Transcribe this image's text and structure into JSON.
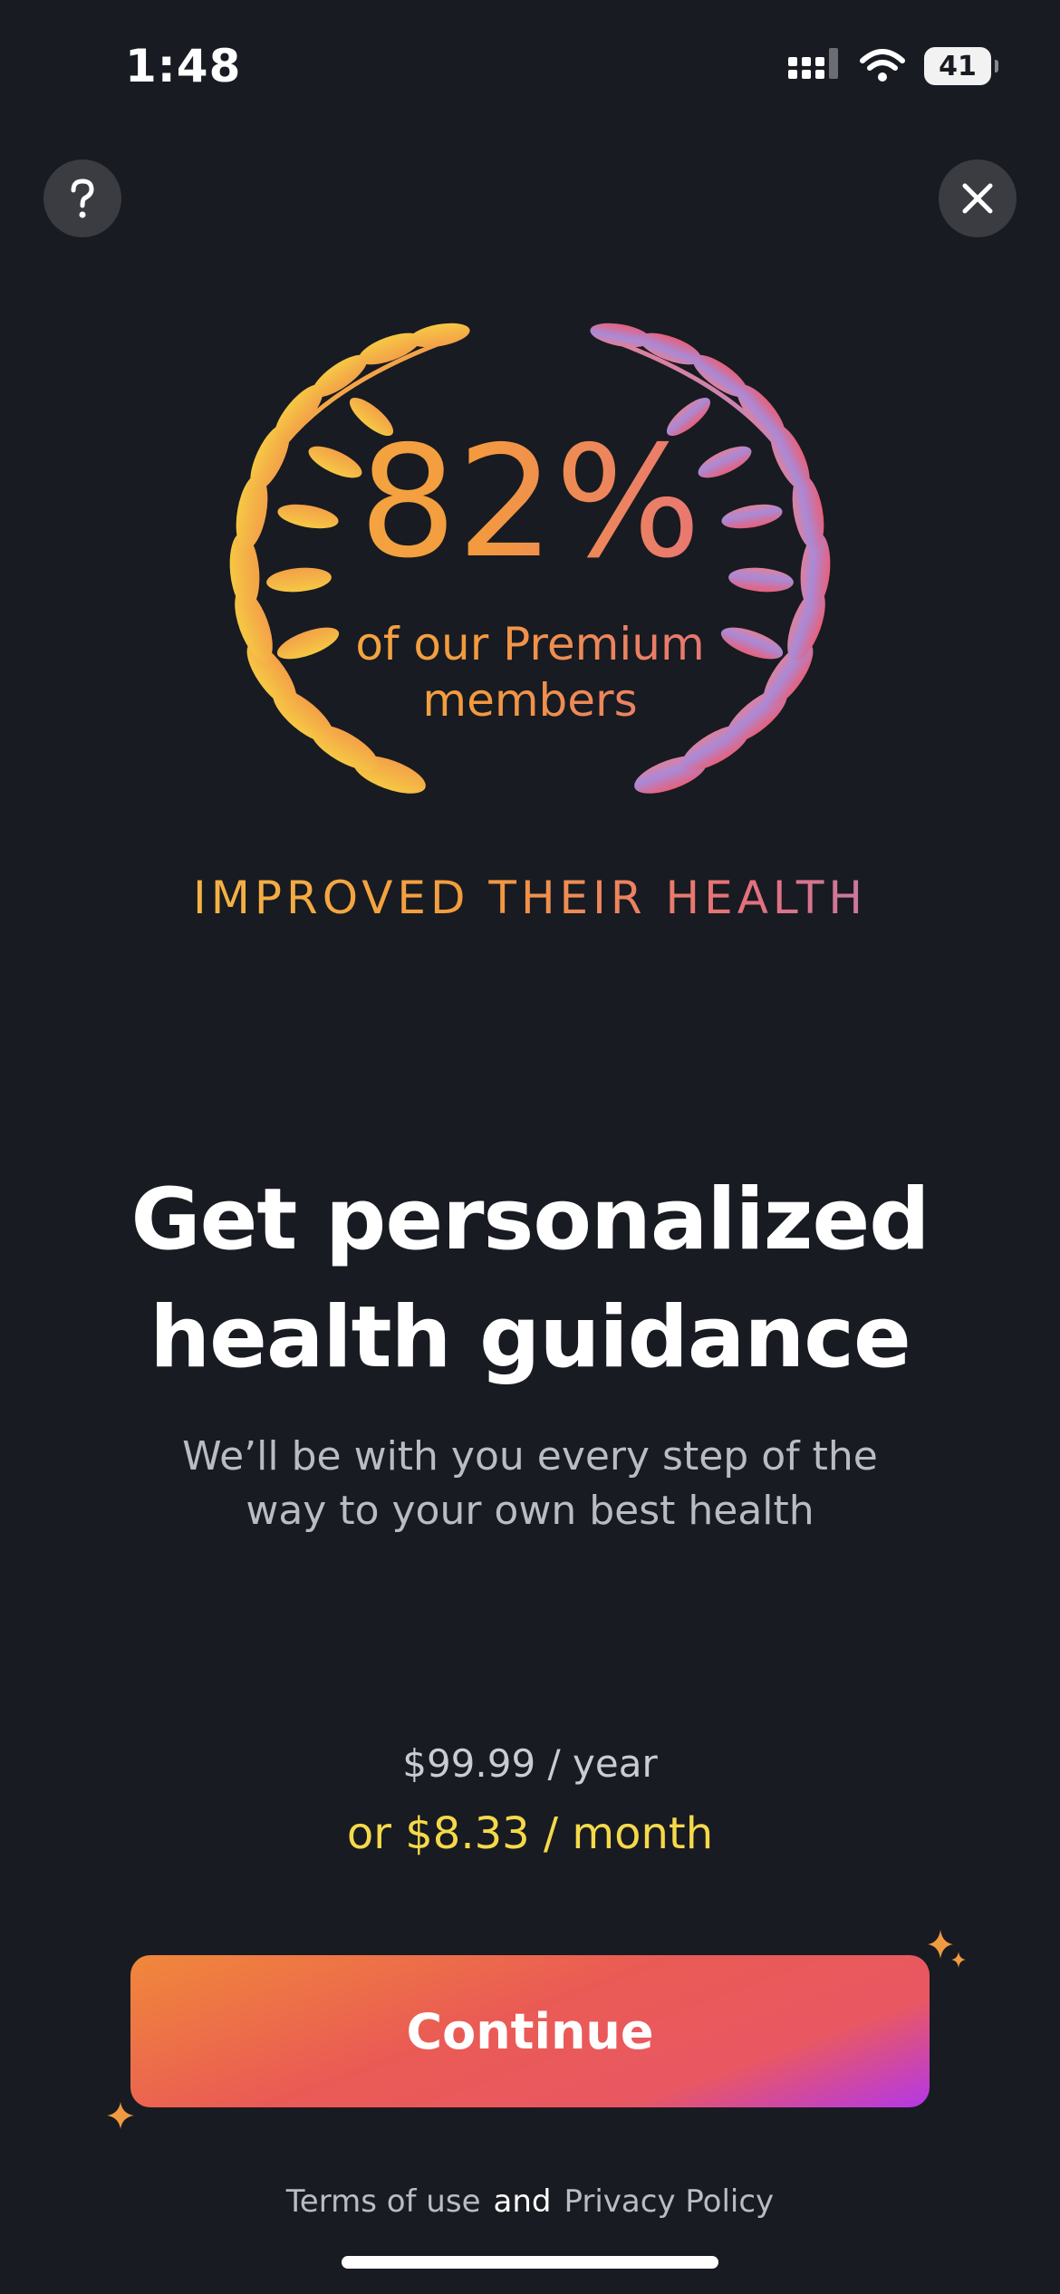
{
  "status_bar": {
    "time": "1:48",
    "battery": "41",
    "signal_icon": "cellular-signal-icon",
    "wifi_icon": "wifi-icon"
  },
  "top_buttons": {
    "help_icon": "question-mark-icon",
    "close_icon": "close-icon"
  },
  "stat": {
    "number": "82%",
    "sub_line1": "of our Premium",
    "sub_line2": "members",
    "caption": "IMPROVED THEIR HEALTH"
  },
  "headline": {
    "line1": "Get personalized",
    "line2": "health guidance"
  },
  "subtext": {
    "line1": "We’ll be with you every step of the",
    "line2": "way to your own best health"
  },
  "pricing": {
    "yearly": "$99.99 / year",
    "monthly": "or $8.33 / month"
  },
  "cta": {
    "label": "Continue"
  },
  "footer": {
    "terms": "Terms of use",
    "and": "and",
    "privacy": "Privacy Policy"
  },
  "colors": {
    "background": "#181b21",
    "accent_yellow": "#f5d94a",
    "gradient_start": "#f6c44a",
    "gradient_end": "#9d86d8"
  }
}
